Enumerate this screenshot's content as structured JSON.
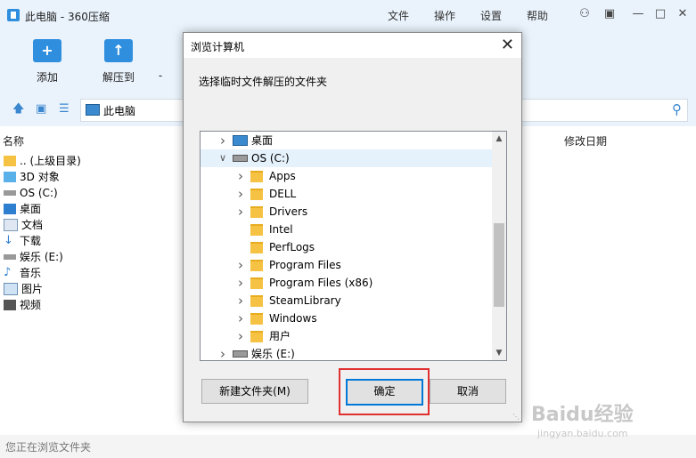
{
  "window": {
    "title": "此电脑 - 360压缩",
    "menus": [
      "文件",
      "操作",
      "设置",
      "帮助"
    ]
  },
  "toolbar": {
    "add_label": "添加",
    "extract_label": "解压到",
    "third_label": "-"
  },
  "address": {
    "path": "此电脑"
  },
  "columns": {
    "name": "名称",
    "modified": "修改日期"
  },
  "files": [
    {
      "label": ".. (上级目录)",
      "icon": "folder-icon"
    },
    {
      "label": "3D 对象",
      "icon": "3d-objects-icon"
    },
    {
      "label": "OS (C:)",
      "icon": "drive-icon"
    },
    {
      "label": "桌面",
      "icon": "desktop-icon"
    },
    {
      "label": "文档",
      "icon": "documents-icon"
    },
    {
      "label": "下载",
      "icon": "download-icon"
    },
    {
      "label": "娱乐 (E:)",
      "icon": "drive-icon"
    },
    {
      "label": "音乐",
      "icon": "music-icon"
    },
    {
      "label": "图片",
      "icon": "pictures-icon"
    },
    {
      "label": "视频",
      "icon": "videos-icon"
    }
  ],
  "status": {
    "text": "您正在浏览文件夹"
  },
  "dialog": {
    "title": "浏览计算机",
    "prompt": "选择临时文件解压的文件夹",
    "tree": [
      {
        "label": "桌面",
        "level": 0,
        "expander": "collapsed",
        "icon": "desktop-icon"
      },
      {
        "label": "OS (C:)",
        "level": 0,
        "expander": "expanded",
        "icon": "drive-icon",
        "selected": true
      },
      {
        "label": "Apps",
        "level": 1,
        "expander": "collapsed",
        "icon": "folder-icon"
      },
      {
        "label": "DELL",
        "level": 1,
        "expander": "collapsed",
        "icon": "folder-icon"
      },
      {
        "label": "Drivers",
        "level": 1,
        "expander": "collapsed",
        "icon": "folder-icon"
      },
      {
        "label": "Intel",
        "level": 1,
        "expander": "none",
        "icon": "folder-icon"
      },
      {
        "label": "PerfLogs",
        "level": 1,
        "expander": "none",
        "icon": "folder-icon"
      },
      {
        "label": "Program Files",
        "level": 1,
        "expander": "collapsed",
        "icon": "folder-icon"
      },
      {
        "label": "Program Files (x86)",
        "level": 1,
        "expander": "collapsed",
        "icon": "folder-icon"
      },
      {
        "label": "SteamLibrary",
        "level": 1,
        "expander": "collapsed",
        "icon": "folder-icon"
      },
      {
        "label": "Windows",
        "level": 1,
        "expander": "collapsed",
        "icon": "folder-icon"
      },
      {
        "label": "用户",
        "level": 1,
        "expander": "collapsed",
        "icon": "folder-icon"
      },
      {
        "label": "娱乐 (E:)",
        "level": 0,
        "expander": "collapsed",
        "icon": "drive-icon"
      }
    ],
    "buttons": {
      "new_folder": "新建文件夹(M)",
      "ok": "确定",
      "cancel": "取消"
    }
  },
  "watermark": {
    "brand": "Baidu经验",
    "url": "jingyan.baidu.com"
  },
  "colors": {
    "accent": "#2f8fde",
    "highlight_box": "#e03030",
    "chrome": "#eaf3fc"
  }
}
